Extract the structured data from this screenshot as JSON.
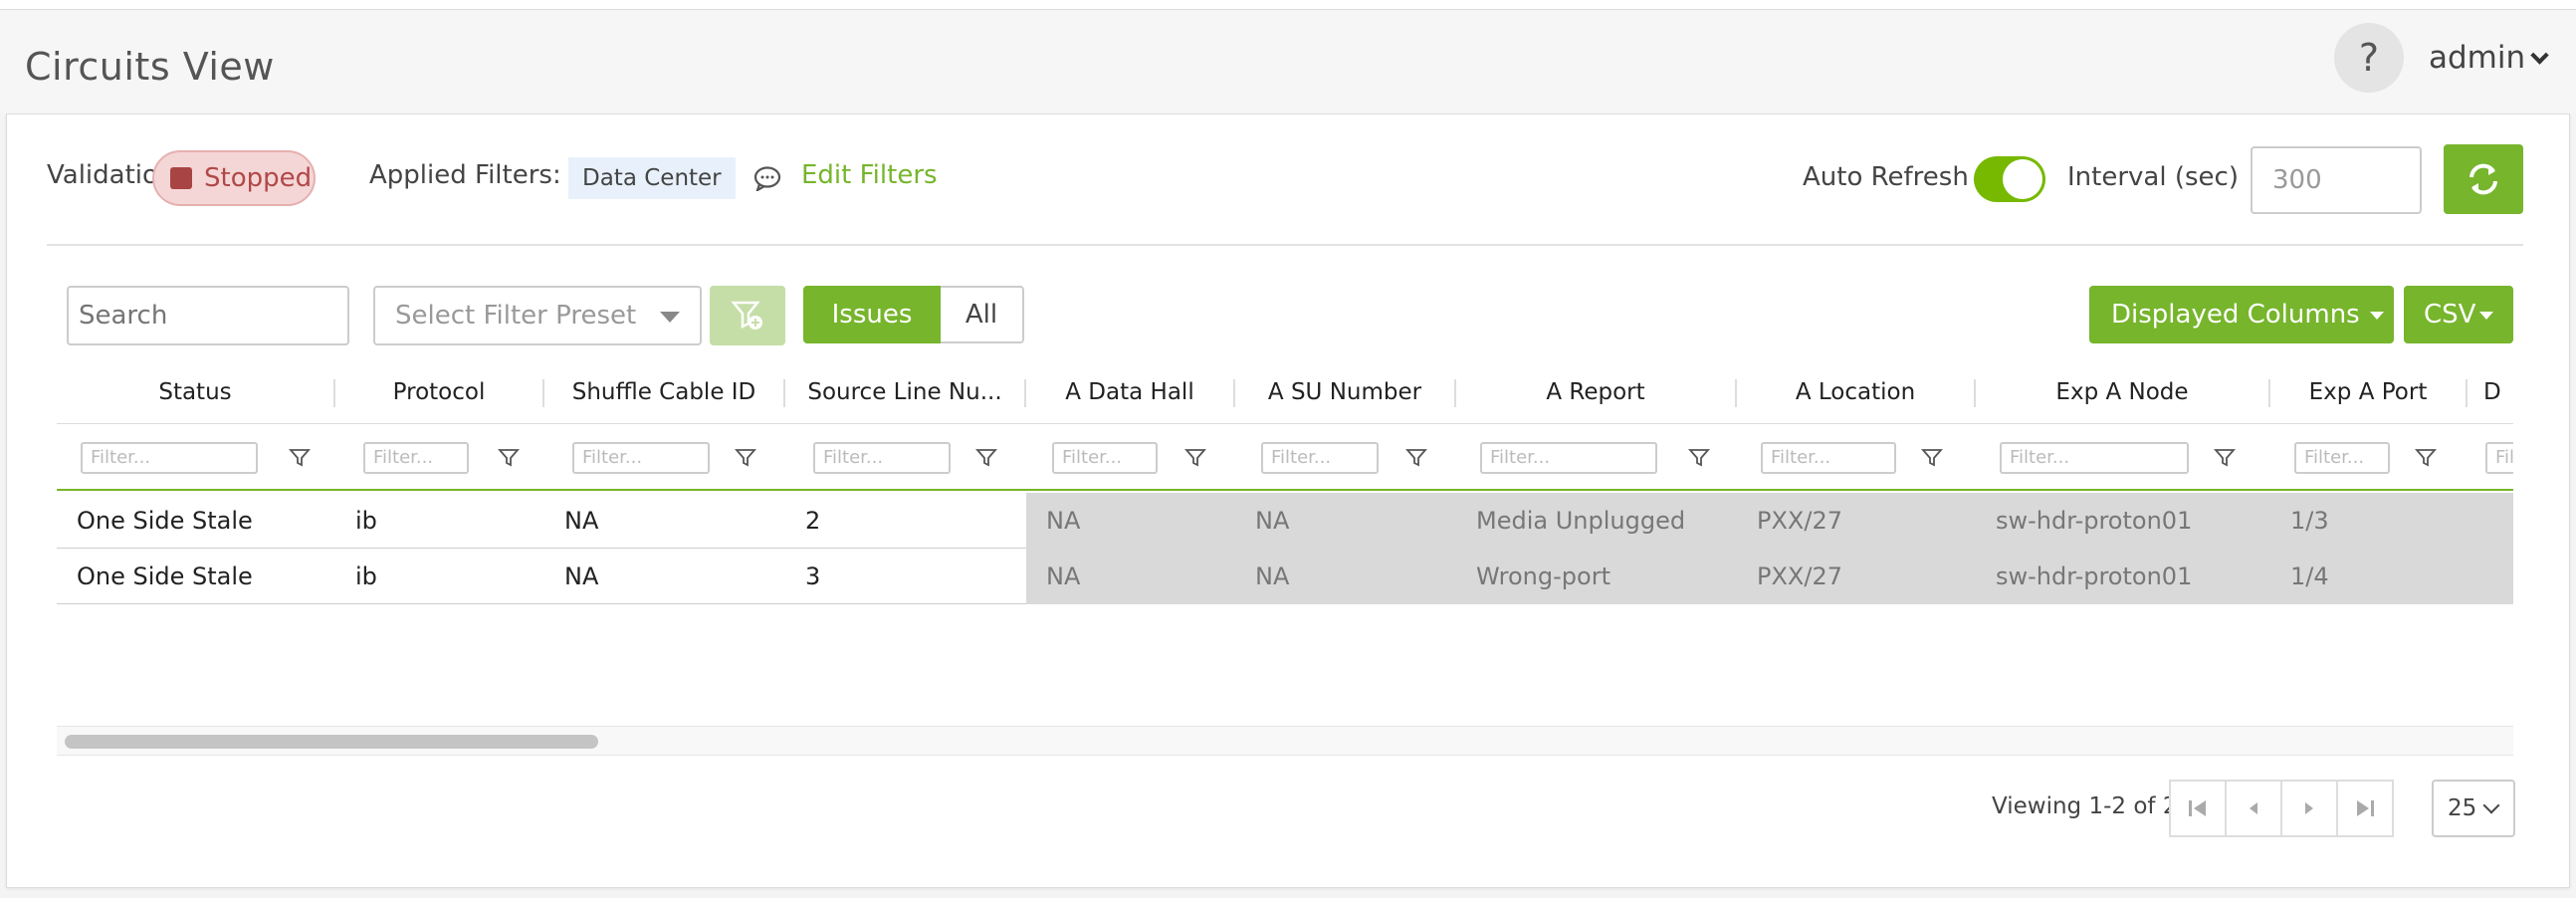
{
  "header": {
    "page_title": "Circuits View",
    "help_label": "?",
    "user_label": "admin"
  },
  "toolbar": {
    "validation_label": "Validation",
    "validation_status": "Stopped",
    "applied_filters_label": "Applied Filters:",
    "applied_filter_chip": "Data Center",
    "edit_filters_label": "Edit Filters",
    "auto_refresh_label": "Auto Refresh",
    "auto_refresh_on": true,
    "interval_label": "Interval (sec)",
    "interval_value": "300"
  },
  "controls": {
    "search_placeholder": "Search",
    "filter_preset_placeholder": "Select Filter Preset",
    "segment_issues": "Issues",
    "segment_all": "All",
    "displayed_columns_label": "Displayed Columns",
    "csv_label": "CSV"
  },
  "table": {
    "columns": [
      "Status",
      "Protocol",
      "Shuffle Cable ID",
      "Source Line Nu...",
      "A Data Hall",
      "A SU Number",
      "A Report",
      "A Location",
      "Exp A Node",
      "Exp A Port",
      "D"
    ],
    "filter_placeholder": "Filter...",
    "rows": [
      [
        "One Side Stale",
        "ib",
        "NA",
        "2",
        "NA",
        "NA",
        "Media Unplugged",
        "PXX/27",
        "sw-hdr-proton01",
        "1/3",
        ""
      ],
      [
        "One Side Stale",
        "ib",
        "NA",
        "3",
        "NA",
        "NA",
        "Wrong-port",
        "PXX/27",
        "sw-hdr-proton01",
        "1/4",
        ""
      ]
    ]
  },
  "pagination": {
    "viewing_text": "Viewing 1-2 of 2",
    "page_size": "25"
  },
  "colors": {
    "accent": "#76b52c",
    "stopped_bg": "#f5d6d6",
    "stopped_text": "#b04848",
    "grey_cell": "#d9d9d9"
  }
}
